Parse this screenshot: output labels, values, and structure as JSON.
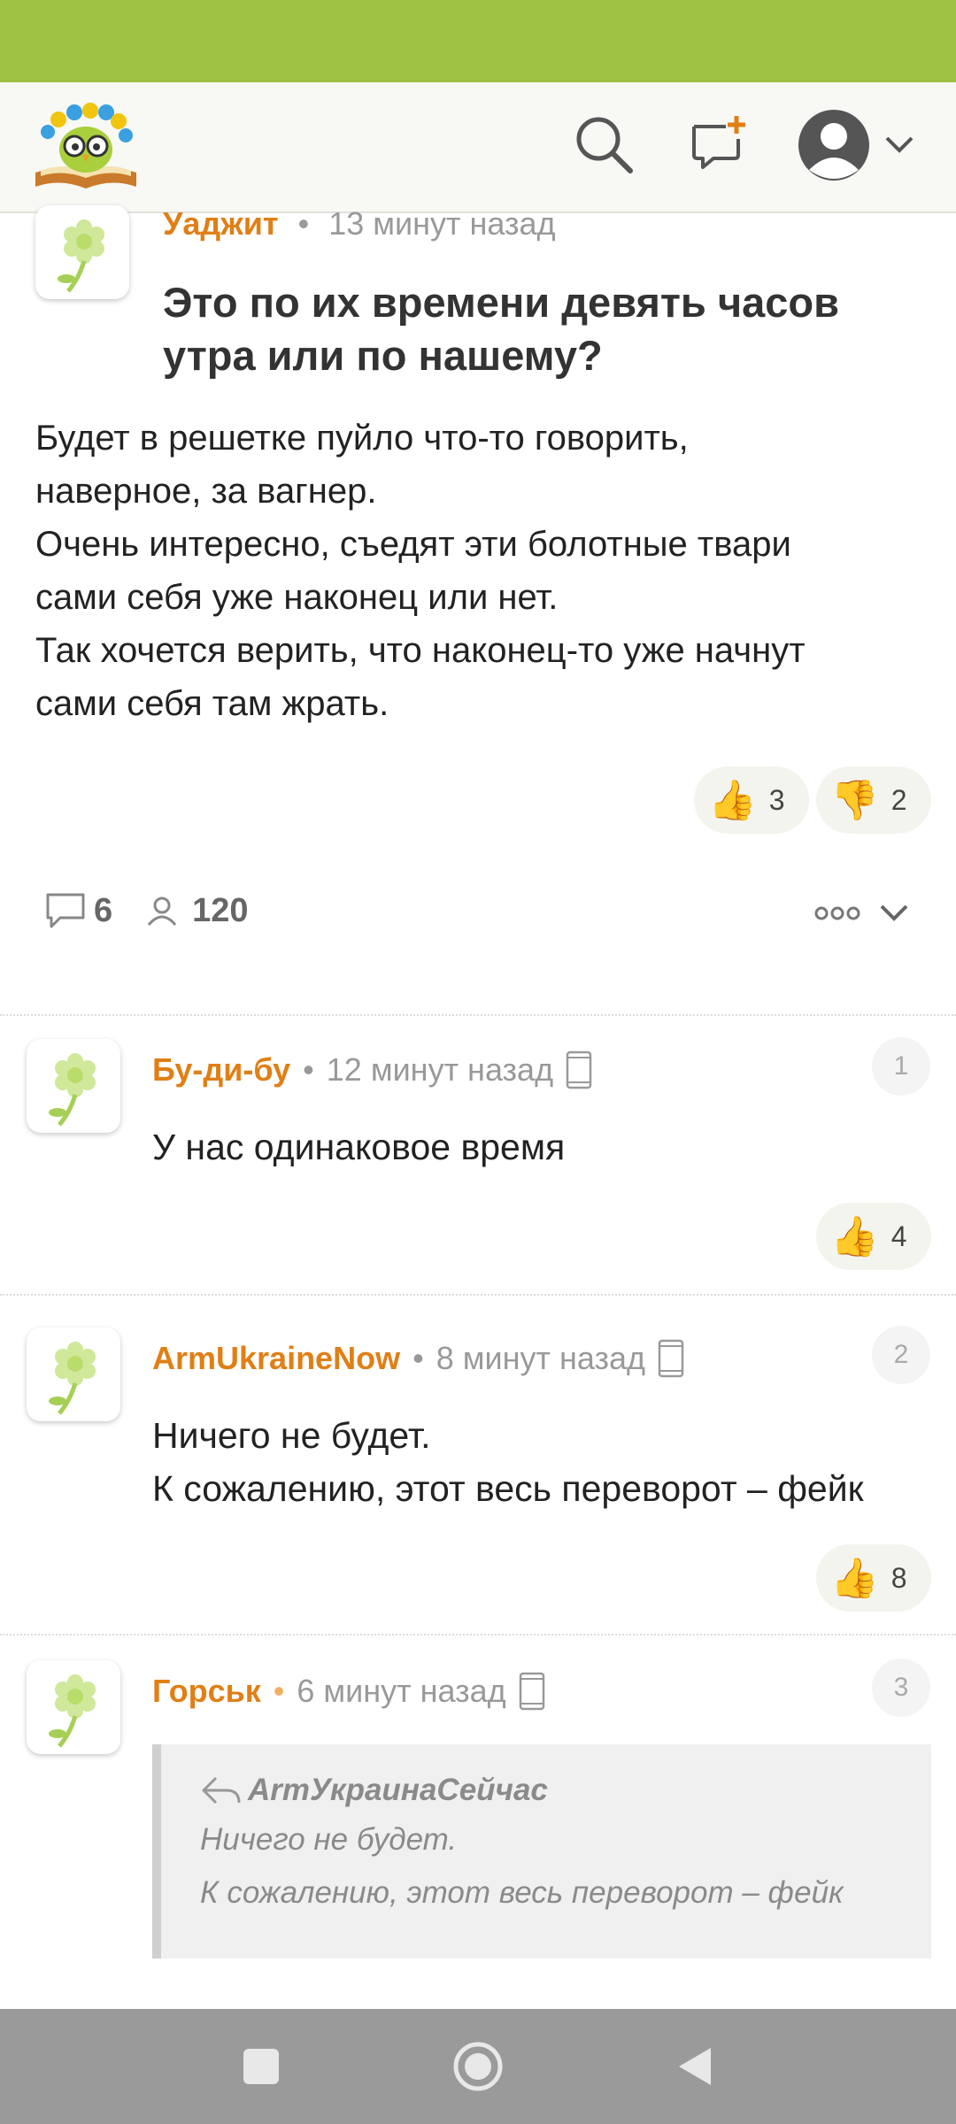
{
  "post": {
    "author": "Уаджит",
    "time": "13 минут назад",
    "title": "Это по их времени девять часов утра или по нашему?",
    "body_lines": [
      "Будет в решетке пуйло что-то говорить,",
      "наверное, за вагнер.",
      "Очень интересно, съедят эти болотные твари",
      "сами себя уже наконец или нет.",
      "Так хочется верить, что наконец-то уже начнут",
      "сами себя там жрать."
    ],
    "likes": "3",
    "dislikes": "2",
    "comments_count": "6",
    "views": "120"
  },
  "comments": [
    {
      "author": "Бу-ди-бу",
      "time": "12 минут назад",
      "number": "1",
      "lines": [
        "У нас одинаковое время"
      ],
      "likes": "4"
    },
    {
      "author": "ArmUkraineNow",
      "time": "8 минут назад",
      "number": "2",
      "lines": [
        "Ничего не будет.",
        "К сожалению, этот весь переворот – фейк"
      ],
      "likes": "8"
    },
    {
      "author": "Горськ",
      "time": "6 минут назад",
      "number": "3",
      "quote": {
        "author": "АrmУкраинаСейчас",
        "lines": [
          "Ничего не будет.",
          "К сожалению, этот весь переворот – фейк"
        ]
      }
    }
  ],
  "colors": {
    "status_bar": "#9dc142",
    "author": "#e07f16",
    "nav_bar": "#9a9a9a"
  },
  "icons": {
    "logo": "owl-book-logo",
    "search": "search-icon",
    "new_post": "new-post-icon",
    "profile": "profile-avatar-icon"
  }
}
